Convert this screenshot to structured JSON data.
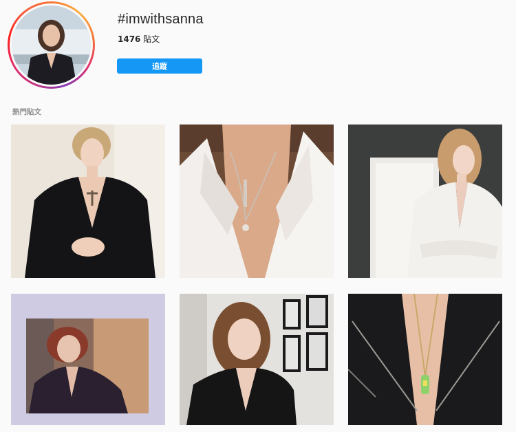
{
  "header": {
    "hashtag": "#imwithsanna",
    "post_count_number": "1476",
    "post_count_unit": " 貼文",
    "follow_label": "追蹤"
  },
  "section": {
    "top_posts_title": "熱門貼文"
  },
  "colors": {
    "follow_button": "#1598f5",
    "background": "#fafafa"
  },
  "posts": [
    {
      "description": "woman in black blazer with cross necklace"
    },
    {
      "description": "white blazer with pendant necklaces close-up"
    },
    {
      "description": "woman in white blazer arms crossed"
    },
    {
      "description": "woman in dark blazer on lavender frame"
    },
    {
      "description": "woman in black blazer selfie in room with framed pictures"
    },
    {
      "description": "black blazer with long necklace close-up"
    }
  ]
}
